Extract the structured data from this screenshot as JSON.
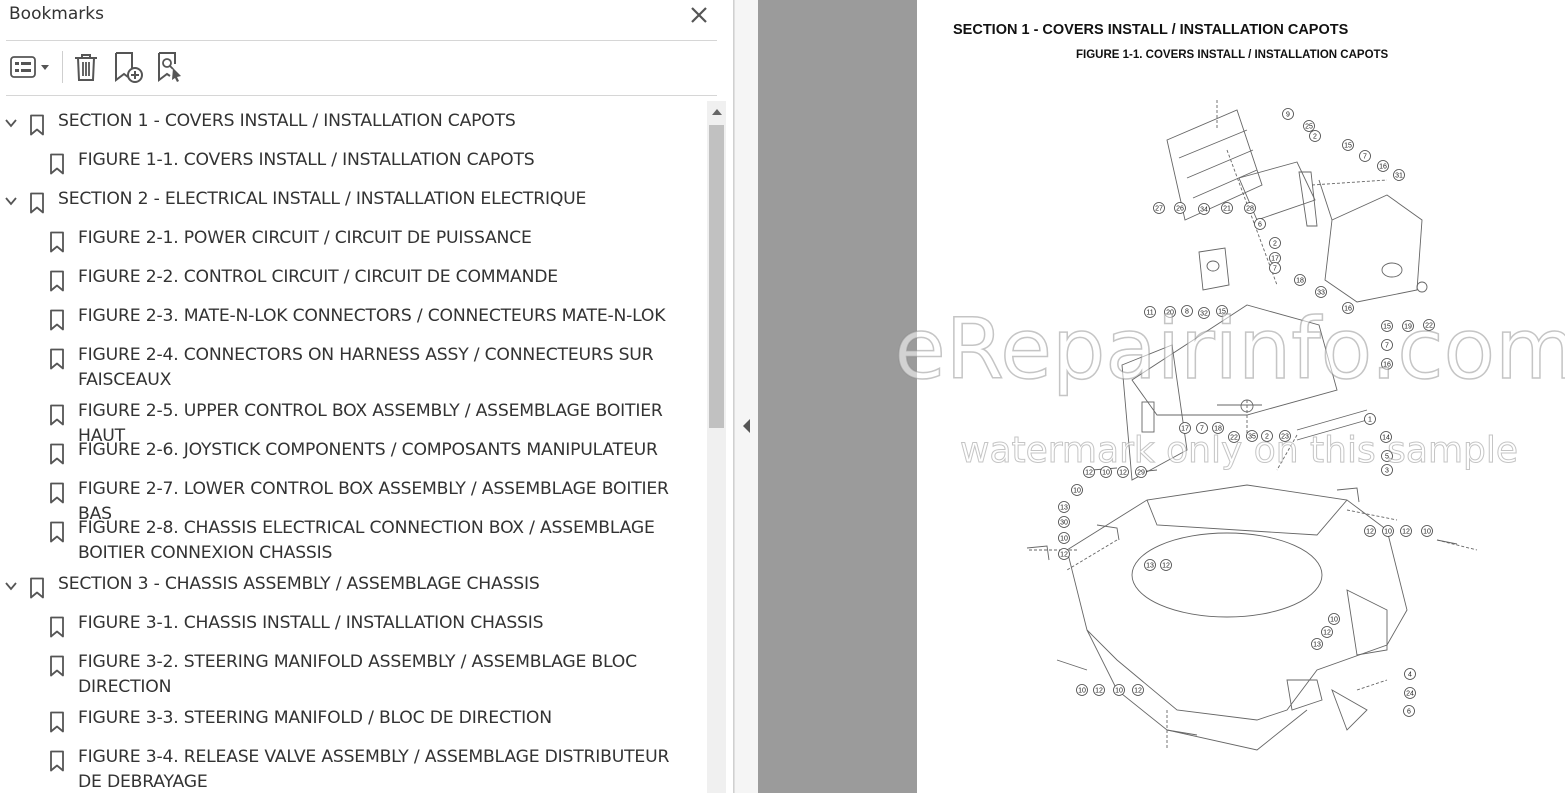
{
  "panel": {
    "title": "Bookmarks",
    "close_icon": "close-icon"
  },
  "toolbar": {
    "options_icon": "list-options-icon",
    "delete_icon": "trash-icon",
    "new_icon": "new-bookmark-icon",
    "find_icon": "find-bookmark-icon"
  },
  "bookmarks": [
    {
      "label": "SECTION 1 - COVERS INSTALL / INSTALLATION CAPOTS",
      "level": 0,
      "expanded": true
    },
    {
      "label": "FIGURE 1-1. COVERS INSTALL / INSTALLATION CAPOTS",
      "level": 1
    },
    {
      "label": "SECTION 2 - ELECTRICAL INSTALL / INSTALLATION ELECTRIQUE",
      "level": 0,
      "expanded": true
    },
    {
      "label": "FIGURE 2-1. POWER CIRCUIT / CIRCUIT DE PUISSANCE",
      "level": 1
    },
    {
      "label": "FIGURE 2-2. CONTROL CIRCUIT / CIRCUIT DE COMMANDE",
      "level": 1
    },
    {
      "label": "FIGURE 2-3. MATE-N-LOK CONNECTORS / CONNECTEURS MATE-N-LOK",
      "level": 1
    },
    {
      "label": "FIGURE 2-4. CONNECTORS ON HARNESS ASSY / CONNECTEURS SUR FAISCEAUX",
      "level": 1
    },
    {
      "label": "FIGURE 2-5. UPPER CONTROL BOX ASSEMBLY / ASSEMBLAGE BOITIER HAUT",
      "level": 1
    },
    {
      "label": "FIGURE 2-6. JOYSTICK COMPONENTS / COMPOSANTS MANIPULATEUR",
      "level": 1
    },
    {
      "label": "FIGURE 2-7. LOWER CONTROL BOX ASSEMBLY / ASSEMBLAGE BOITIER BAS",
      "level": 1
    },
    {
      "label": "FIGURE 2-8. CHASSIS ELECTRICAL CONNECTION BOX / ASSEMBLAGE BOITIER CONNEXION CHASSIS",
      "level": 1
    },
    {
      "label": "SECTION 3 - CHASSIS ASSEMBLY / ASSEMBLAGE CHASSIS",
      "level": 0,
      "expanded": true
    },
    {
      "label": "FIGURE 3-1. CHASSIS INSTALL / INSTALLATION CHASSIS",
      "level": 1
    },
    {
      "label": "FIGURE 3-2. STEERING MANIFOLD ASSEMBLY / ASSEMBLAGE BLOC DIRECTION",
      "level": 1
    },
    {
      "label": "FIGURE 3-3. STEERING MANIFOLD / BLOC DE DIRECTION",
      "level": 1
    },
    {
      "label": "FIGURE 3-4. RELEASE VALVE ASSEMBLY / ASSEMBLAGE DISTRIBUTEUR DE DEBRAYAGE",
      "level": 1
    }
  ],
  "document": {
    "section_heading": "SECTION 1 - COVERS INSTALL / INSTALLATION CAPOTS",
    "figure_heading": "FIGURE 1-1. COVERS INSTALL / INSTALLATION CAPOTS",
    "callouts": [
      "9",
      "25",
      "2",
      "15",
      "7",
      "16",
      "31",
      "27",
      "26",
      "34",
      "21",
      "28",
      "6",
      "2",
      "17",
      "7",
      "18",
      "33",
      "11",
      "20",
      "8",
      "32",
      "15",
      "16",
      "15",
      "7",
      "16",
      "19",
      "22",
      "17",
      "7",
      "18",
      "22",
      "35",
      "2",
      "23",
      "1",
      "14",
      "5",
      "3",
      "12",
      "10",
      "12",
      "29",
      "10",
      "13",
      "30",
      "10",
      "12",
      "13",
      "12",
      "12",
      "10",
      "12",
      "10",
      "10",
      "12",
      "13",
      "4",
      "24",
      "6",
      "10",
      "12",
      "10",
      "12"
    ],
    "watermark_main": "eRepairinfo.com",
    "watermark_sub": "watermark only on this sample"
  },
  "colors": {
    "gutter": "#9b9b9b",
    "text": "#333333",
    "icon": "#555555"
  }
}
